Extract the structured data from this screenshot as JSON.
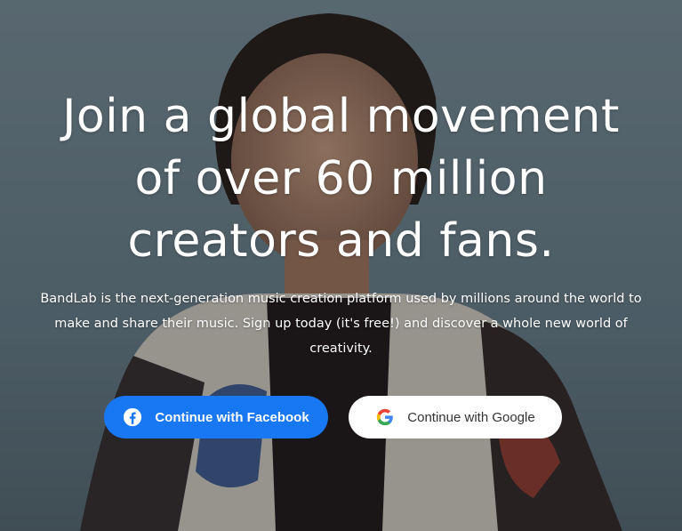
{
  "hero": {
    "headline_lines": [
      "Join a global movement",
      "of over 60 million",
      "creators and fans."
    ],
    "description": "BandLab is the next-generation music creation platform used by millions around the world to make and share their music. Sign up today (it's free!) and discover a whole new world of creativity."
  },
  "buttons": {
    "facebook": {
      "label": "Continue with Facebook",
      "icon": "facebook-icon",
      "color": "#1877f2"
    },
    "google": {
      "label": "Continue with Google",
      "icon": "google-icon",
      "color": "#ffffff"
    }
  }
}
